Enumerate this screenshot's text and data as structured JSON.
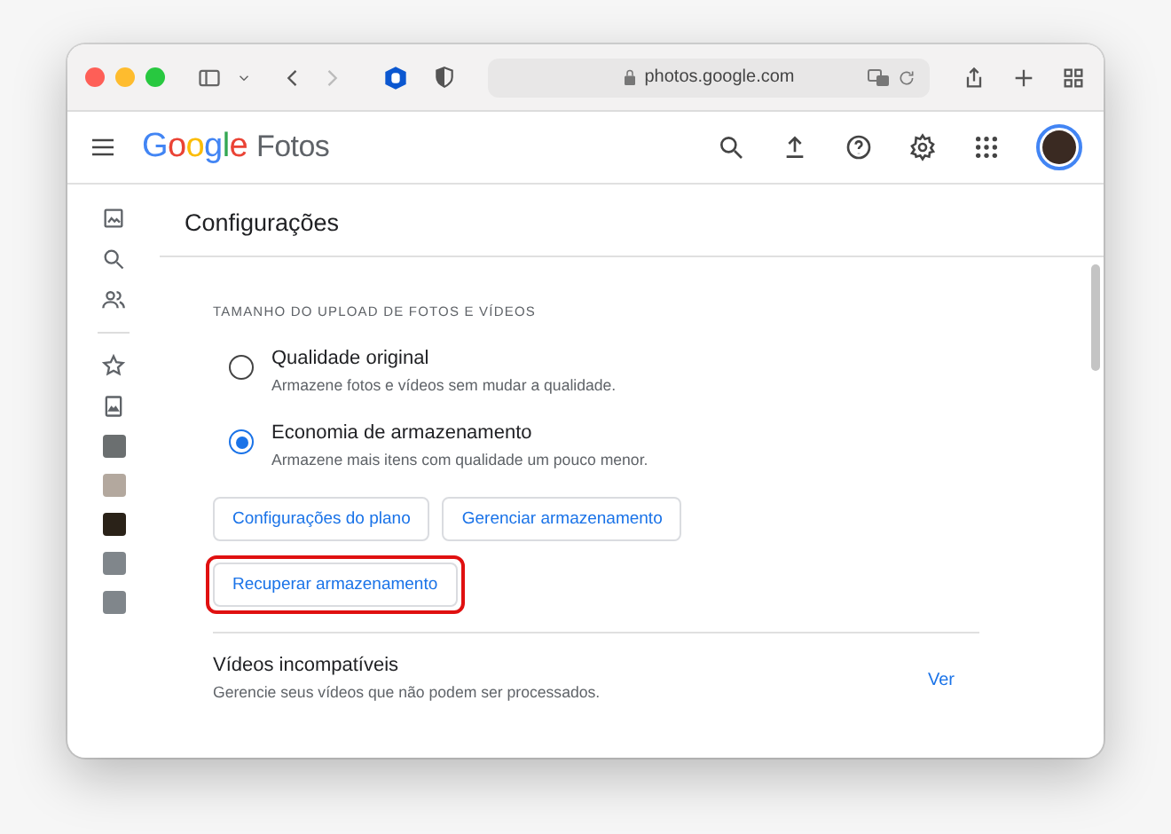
{
  "browser": {
    "address": "photos.google.com"
  },
  "app": {
    "logo": "Google",
    "product": "Fotos"
  },
  "page": {
    "title": "Configurações"
  },
  "upload_size": {
    "heading": "TAMANHO DO UPLOAD DE FOTOS E VÍDEOS",
    "options": [
      {
        "label": "Qualidade original",
        "description": "Armazene fotos e vídeos sem mudar a qualidade.",
        "selected": false
      },
      {
        "label": "Economia de armazenamento",
        "description": "Armazene mais itens com qualidade um pouco menor.",
        "selected": true
      }
    ],
    "buttons": [
      {
        "label": "Configurações do plano",
        "highlighted": false
      },
      {
        "label": "Gerenciar armazenamento",
        "highlighted": false
      },
      {
        "label": "Recuperar armazenamento",
        "highlighted": true
      }
    ]
  },
  "incompatible_videos": {
    "title": "Vídeos incompatíveis",
    "description": "Gerencie seus vídeos que não podem ser processados.",
    "action": "Ver"
  }
}
